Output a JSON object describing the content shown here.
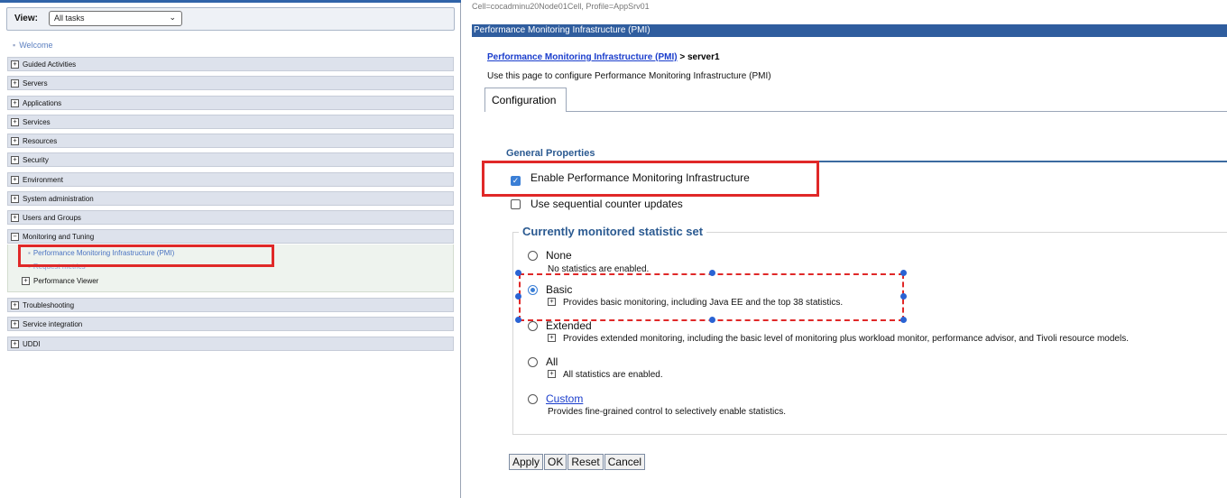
{
  "nav": {
    "view_label": "View:",
    "view_selected": "All tasks",
    "welcome": "Welcome",
    "categories": [
      {
        "label": "Guided Activities",
        "expanded": false
      },
      {
        "label": "Servers",
        "expanded": false
      },
      {
        "label": "Applications",
        "expanded": false
      },
      {
        "label": "Services",
        "expanded": false
      },
      {
        "label": "Resources",
        "expanded": false
      },
      {
        "label": "Security",
        "expanded": false
      },
      {
        "label": "Environment",
        "expanded": false
      },
      {
        "label": "System administration",
        "expanded": false
      },
      {
        "label": "Users and Groups",
        "expanded": false
      },
      {
        "label": "Monitoring and Tuning",
        "expanded": true
      },
      {
        "label": "Troubleshooting",
        "expanded": false
      },
      {
        "label": "Service integration",
        "expanded": false
      },
      {
        "label": "UDDI",
        "expanded": false
      }
    ],
    "monitoring_children": {
      "pmi": "Performance Monitoring Infrastructure (PMI)",
      "request_metrics": "Request metrics",
      "performance_viewer": "Performance Viewer"
    }
  },
  "content": {
    "cell_profile": "Cell=cocadminu20Node01Cell, Profile=AppSrv01",
    "title_bar": "Performance Monitoring Infrastructure (PMI)",
    "breadcrumb_link": "Performance Monitoring Infrastructure (PMI)",
    "breadcrumb_tail": " > server1",
    "description": "Use this page to configure Performance Monitoring Infrastructure (PMI)",
    "tab_configuration": "Configuration",
    "general_properties": "General Properties",
    "enable_pmi": {
      "label": "Enable Performance Monitoring Infrastructure",
      "checked": true
    },
    "sequential_updates": {
      "label": "Use sequential counter updates",
      "checked": false
    },
    "statistic_set_legend": "Currently monitored statistic set",
    "options": {
      "none": {
        "label": "None",
        "desc": "No statistics are enabled.",
        "selected": false
      },
      "basic": {
        "label": "Basic",
        "desc": "Provides basic monitoring, including Java EE and the top 38 statistics.",
        "selected": true
      },
      "extended": {
        "label": "Extended",
        "desc": "Provides extended monitoring, including the basic level of monitoring plus workload monitor, performance advisor, and Tivoli resource models.",
        "selected": false
      },
      "all": {
        "label": "All",
        "desc": "All statistics are enabled.",
        "selected": false
      },
      "custom": {
        "label": "Custom",
        "desc": "Provides fine-grained control to selectively enable statistics.",
        "selected": false
      }
    },
    "buttons": {
      "apply": "Apply",
      "ok": "OK",
      "reset": "Reset",
      "cancel": "Cancel"
    }
  },
  "colors": {
    "highlight_red": "#e02828",
    "title_bar_blue": "#2f5d9e",
    "link_blue": "#1a3dcc",
    "check_blue": "#3b7fd6"
  }
}
